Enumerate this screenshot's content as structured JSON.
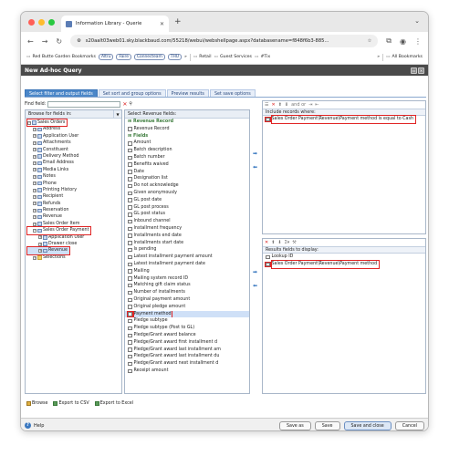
{
  "browser": {
    "tab_title": "Information Library - Querie",
    "url": "s20aalt03web01.sky.blackbaud.com/55218/webui/webshellpage.aspx?databasename=f848f6b3-885...",
    "bookmarks": [
      {
        "label": "Red Butte Garden Bookmarks",
        "kind": "text"
      },
      {
        "label": "Altru",
        "kind": "chip"
      },
      {
        "label": "Faire",
        "kind": "chip"
      },
      {
        "label": "Connecteam",
        "kind": "chip"
      },
      {
        "label": "THU",
        "kind": "chip"
      }
    ],
    "bookmarks_right": [
      "Retail",
      "Guest Services",
      "#Tix"
    ],
    "all_bookmarks": "All Bookmarks",
    "more": "»"
  },
  "query": {
    "title": "New Ad-hoc Query",
    "tabs": [
      "Select filter and output fields",
      "Set sort and group options",
      "Preview results",
      "Set save options"
    ],
    "find_label": "Find field:",
    "browse_label": "Browse for fields in:",
    "tree": [
      {
        "label": "Sales Orders",
        "level": 0,
        "exp": "−",
        "folder": false,
        "hl": true
      },
      {
        "label": "Address",
        "level": 1,
        "exp": "+",
        "folder": false,
        "hl": false
      },
      {
        "label": "Application User",
        "level": 1,
        "exp": "+",
        "folder": false,
        "hl": false
      },
      {
        "label": "Attachments",
        "level": 1,
        "exp": "+",
        "folder": false,
        "hl": false
      },
      {
        "label": "Constituent",
        "level": 1,
        "exp": "+",
        "folder": false,
        "hl": false
      },
      {
        "label": "Delivery Method",
        "level": 1,
        "exp": "+",
        "folder": false,
        "hl": false
      },
      {
        "label": "Email Address",
        "level": 1,
        "exp": "+",
        "folder": false,
        "hl": false
      },
      {
        "label": "Media Links",
        "level": 1,
        "exp": "+",
        "folder": false,
        "hl": false
      },
      {
        "label": "Notes",
        "level": 1,
        "exp": "+",
        "folder": false,
        "hl": false
      },
      {
        "label": "Phone",
        "level": 1,
        "exp": "+",
        "folder": false,
        "hl": false
      },
      {
        "label": "Printing History",
        "level": 1,
        "exp": "+",
        "folder": false,
        "hl": false
      },
      {
        "label": "Recipient",
        "level": 1,
        "exp": "+",
        "folder": false,
        "hl": false
      },
      {
        "label": "Refunds",
        "level": 1,
        "exp": "+",
        "folder": false,
        "hl": false
      },
      {
        "label": "Reservation",
        "level": 1,
        "exp": "+",
        "folder": false,
        "hl": false
      },
      {
        "label": "Revenue",
        "level": 1,
        "exp": "+",
        "folder": false,
        "hl": false
      },
      {
        "label": "Sales Order Item",
        "level": 1,
        "exp": "+",
        "folder": false,
        "hl": false
      },
      {
        "label": "Sales Order Payment",
        "level": 1,
        "exp": "−",
        "folder": false,
        "hl": true
      },
      {
        "label": "Application User",
        "level": 2,
        "exp": "+",
        "folder": false,
        "hl": false
      },
      {
        "label": "Drawer close",
        "level": 2,
        "exp": "+",
        "folder": false,
        "hl": false
      },
      {
        "label": "Revenue",
        "level": 2,
        "exp": "+",
        "folder": false,
        "hl": true,
        "sel": true
      },
      {
        "label": "Selections",
        "level": 1,
        "exp": "+",
        "folder": true,
        "hl": false
      }
    ],
    "fields_header": "Select Revenue fields:",
    "fields_group1": "Revenue Record",
    "fields_group1_items": [
      "Revenue Record"
    ],
    "fields_group2": "Fields",
    "fields": [
      "Amount",
      "Batch description",
      "Batch number",
      "Benefits waived",
      "Date",
      "Designation list",
      "Do not acknowledge",
      "Given anonymously",
      "GL post date",
      "GL post process",
      "GL post status",
      "Inbound channel",
      "Installment frequency",
      "Installments end date",
      "Installments start date",
      "Is pending",
      "Latest installment payment amount",
      "Latest installment payment date",
      "Mailing",
      "Mailing system record ID",
      "Matching gift claim status",
      "Number of installments",
      "Original payment amount",
      "Original pledge amount",
      "Payment method",
      "Pledge subtype",
      "Pledge subtype (Post to GL)",
      "Pledge/Grant award balance",
      "Pledge/Grant award first installment d",
      "Pledge/Grant award last installment am",
      "Pledge/Grant award last installment du",
      "Pledge/Grant award next installment d",
      "Receipt amount"
    ],
    "filter_header": "Include records where:",
    "filter_toolbar": "and  or",
    "filter_rows": [
      "Sales Order Payment\\Revenue\\Payment method is equal to Cash"
    ],
    "results_header": "Results fields to display:",
    "results_rows": [
      "Lookup ID",
      "Sales Order Payment\\Revenue\\Payment method"
    ],
    "bottom_links": [
      "Browse",
      "Export to CSV",
      "Export to Excel"
    ],
    "help": "Help",
    "buttons": [
      "Save as",
      "Save",
      "Save and close",
      "Cancel"
    ]
  }
}
